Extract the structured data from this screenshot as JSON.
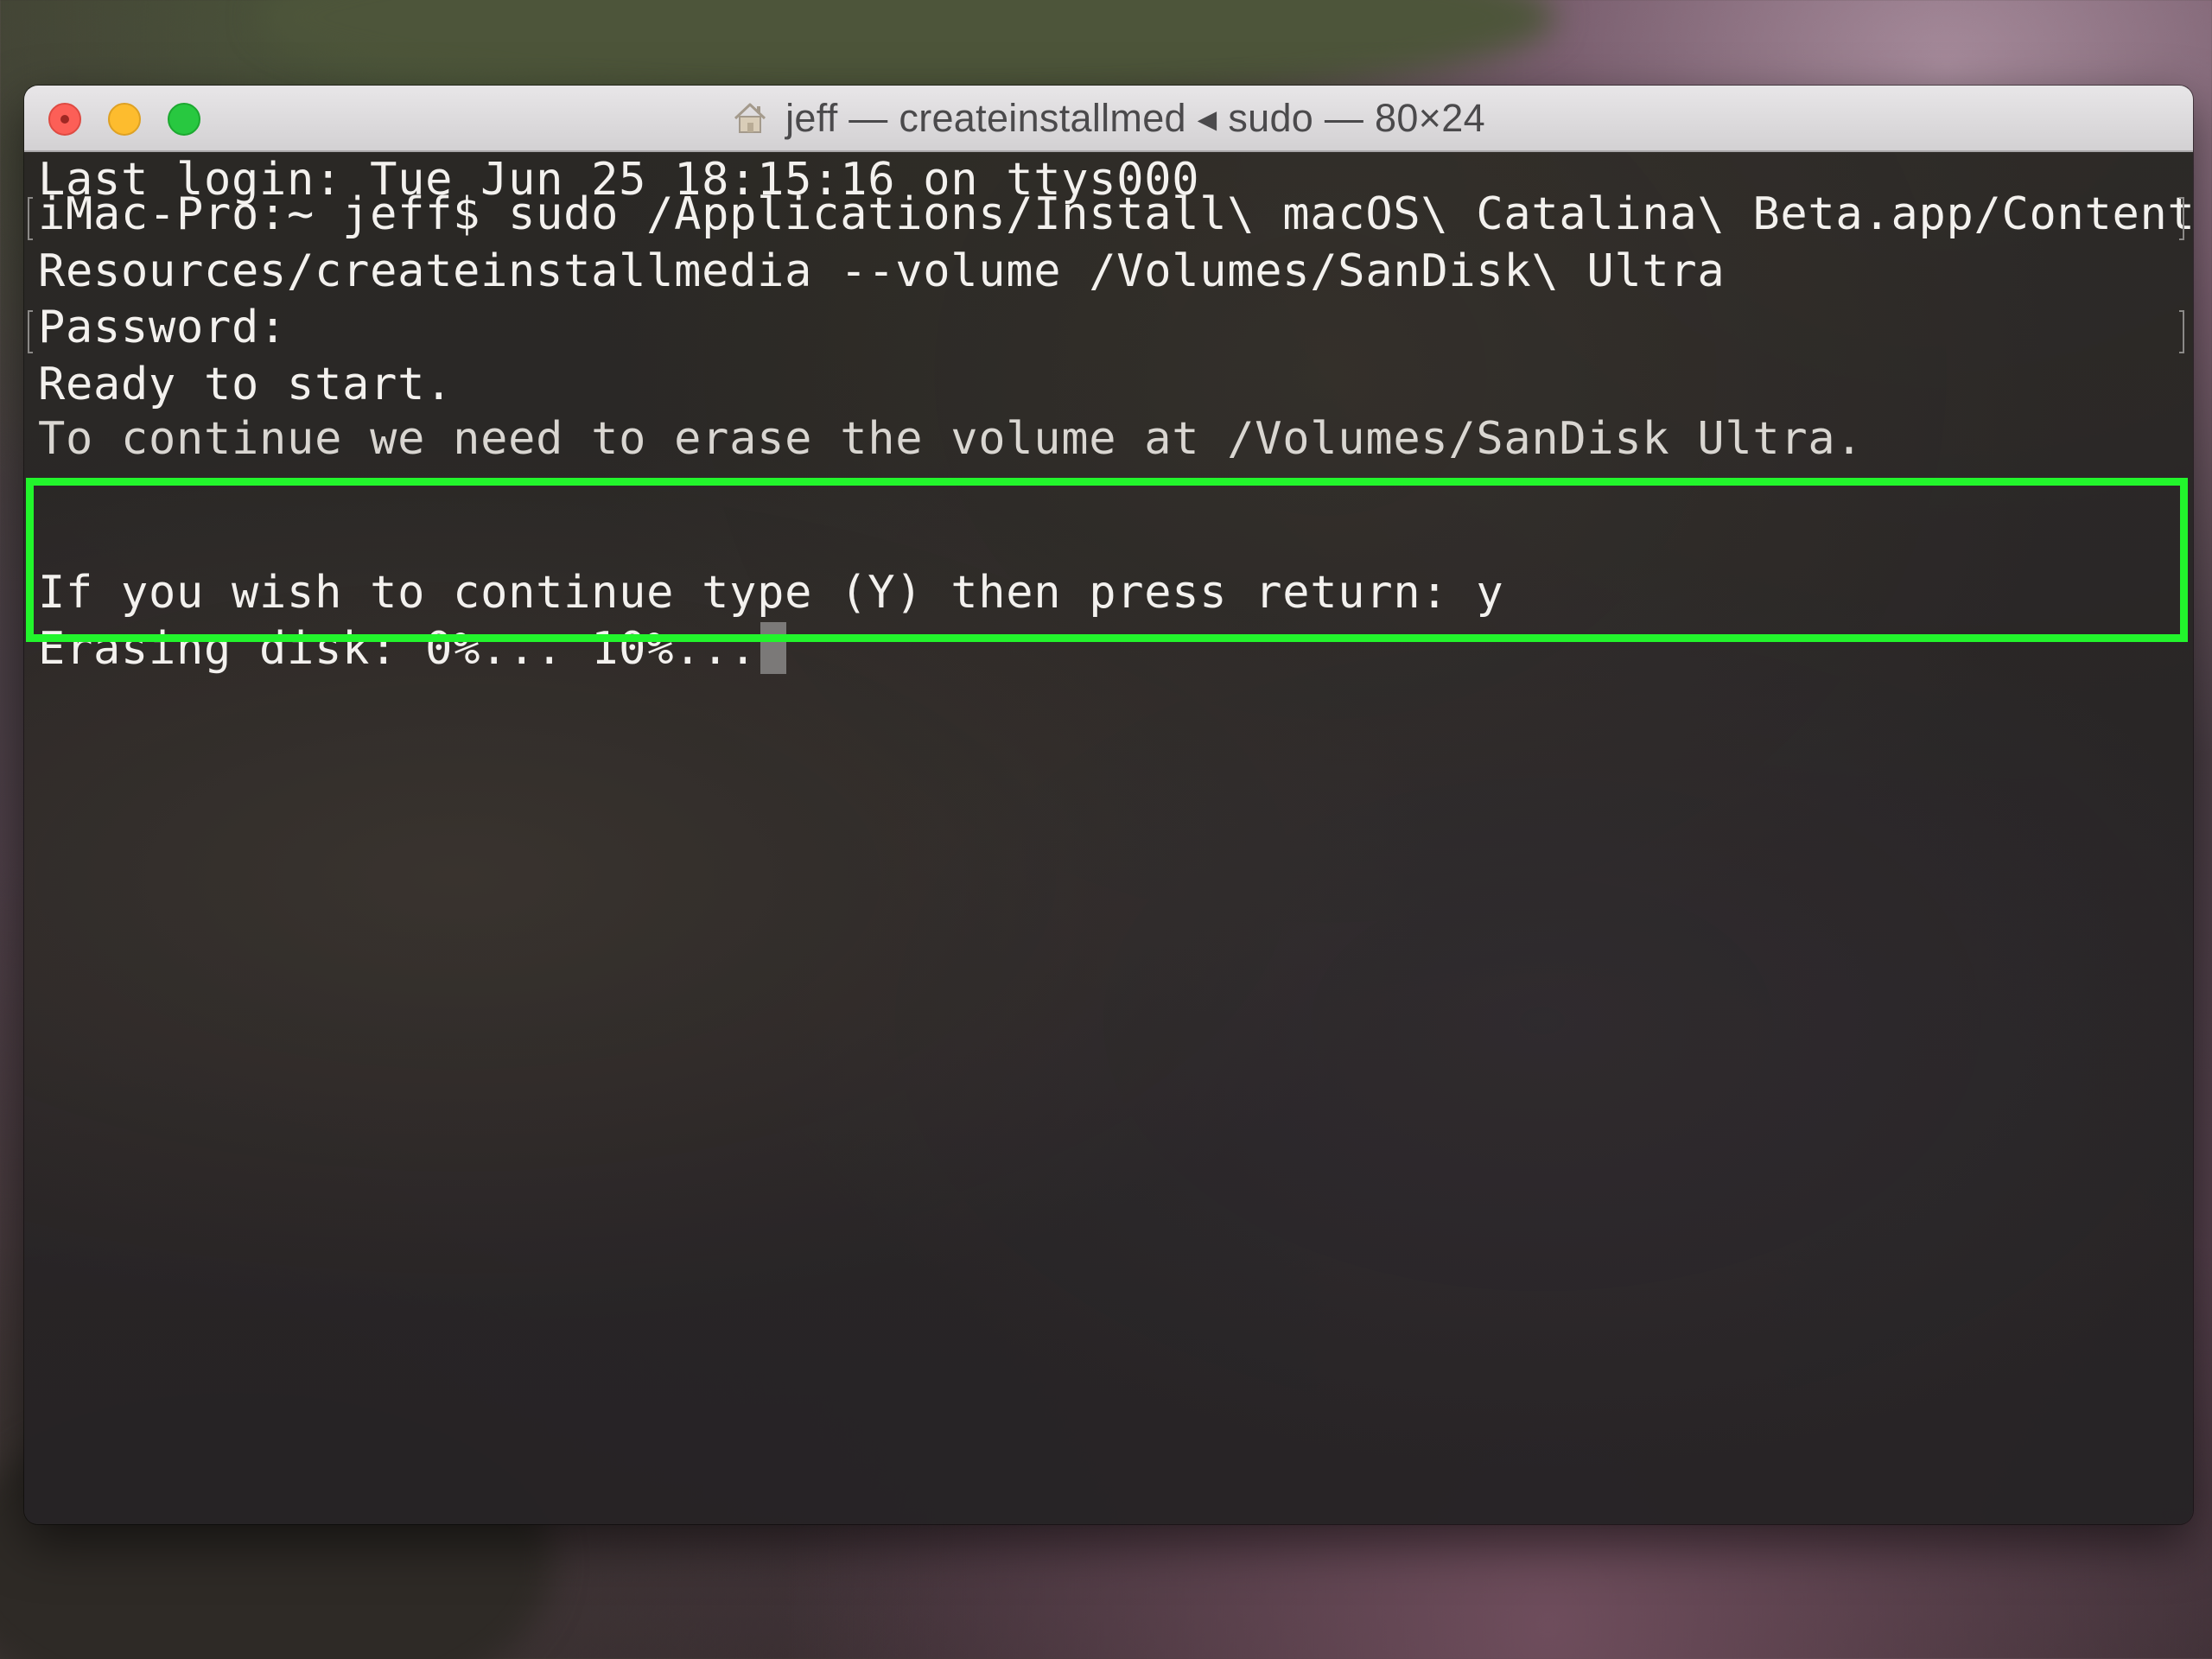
{
  "window": {
    "title": "jeff — createinstallmed ◂ sudo — 80×24"
  },
  "terminal": {
    "lines": [
      "Last login: Tue Jun 25 18:15:16 on ttys000",
      "iMac-Pro:~ jeff$ sudo /Applications/Install\\ macOS\\ Catalina\\ Beta.app/Contents/",
      "Resources/createinstallmedia --volume /Volumes/SanDisk\\ Ultra",
      "Password:",
      "Ready to start.",
      "To continue we need to erase the volume at /Volumes/SanDisk Ultra.",
      "If you wish to continue type (Y) then press return: y",
      "Erasing disk: 0%... 10%..."
    ]
  },
  "colors": {
    "highlight": "#22f52c",
    "terminal_text": "#f3f1ee"
  }
}
